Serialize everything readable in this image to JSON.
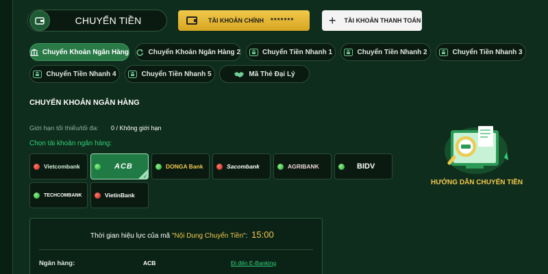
{
  "header": {
    "title": "CHUYỂN TIỀN",
    "main_account_label": "TÀI KHOẢN CHÍNH",
    "main_account_balance": "*******",
    "payment_account_label": "TÀI KHOẢN THANH TOÁN"
  },
  "tabs": [
    {
      "label": "Chuyển Khoản Ngân Hàng",
      "icon": "bank-icon",
      "active": true
    },
    {
      "label": "Chuyển Khoản Ngân Hàng 2",
      "icon": "refresh-icon",
      "active": false
    },
    {
      "label": "Chuyển Tiền Nhanh 1",
      "icon": "bank-icon",
      "active": false
    },
    {
      "label": "Chuyển Tiền Nhanh 2",
      "icon": "bank-icon",
      "active": false
    },
    {
      "label": "Chuyển Tiền Nhanh 3",
      "icon": "bank-icon",
      "active": false
    },
    {
      "label": "Chuyển Tiền Nhanh 4",
      "icon": "bank-icon",
      "active": false
    },
    {
      "label": "Chuyển Tiền Nhanh 5",
      "icon": "bank-icon",
      "active": false
    },
    {
      "label": "Mã Thẻ Đại Lý",
      "icon": "handshake-icon",
      "active": false
    }
  ],
  "section": {
    "title": "CHUYỂN KHOẢN NGÂN HÀNG",
    "limit_label": "Giới hạn tối thiểu/tối đa:",
    "limit_value": "0 / Không giới hạn",
    "choose_label": "Chọn tài khoản ngân hàng:"
  },
  "banks": [
    {
      "name": "Vietcombank",
      "status": "red",
      "selected": false
    },
    {
      "name": "ACB",
      "status": "green",
      "selected": true
    },
    {
      "name": "DONGA Bank",
      "status": "green",
      "selected": false
    },
    {
      "name": "Sacombank",
      "status": "red",
      "selected": false
    },
    {
      "name": "AGRIBANK",
      "status": "green",
      "selected": false
    },
    {
      "name": "BIDV",
      "status": "green",
      "selected": false
    },
    {
      "name": "TECHCOMBANK",
      "status": "green",
      "selected": false
    },
    {
      "name": "VietinBank",
      "status": "red",
      "selected": false
    }
  ],
  "guide": {
    "label": "HƯỚNG DẪN CHUYỂN TIỀN"
  },
  "transfer_info": {
    "validity_prefix": "Thời gian hiệu lực của mã ",
    "validity_highlight": "\"Nội Dung Chuyển Tiền\"",
    "validity_suffix": ":",
    "validity_time": "15:00",
    "bank_label": "Ngân hàng:",
    "bank_value": "ACB",
    "ebanking_link": "Đi đến E-Banking"
  },
  "colors": {
    "background": "#0f2d1c",
    "accent_green": "#2a7a48",
    "gold": "#f2c94c",
    "link_green": "#2fd07a"
  }
}
